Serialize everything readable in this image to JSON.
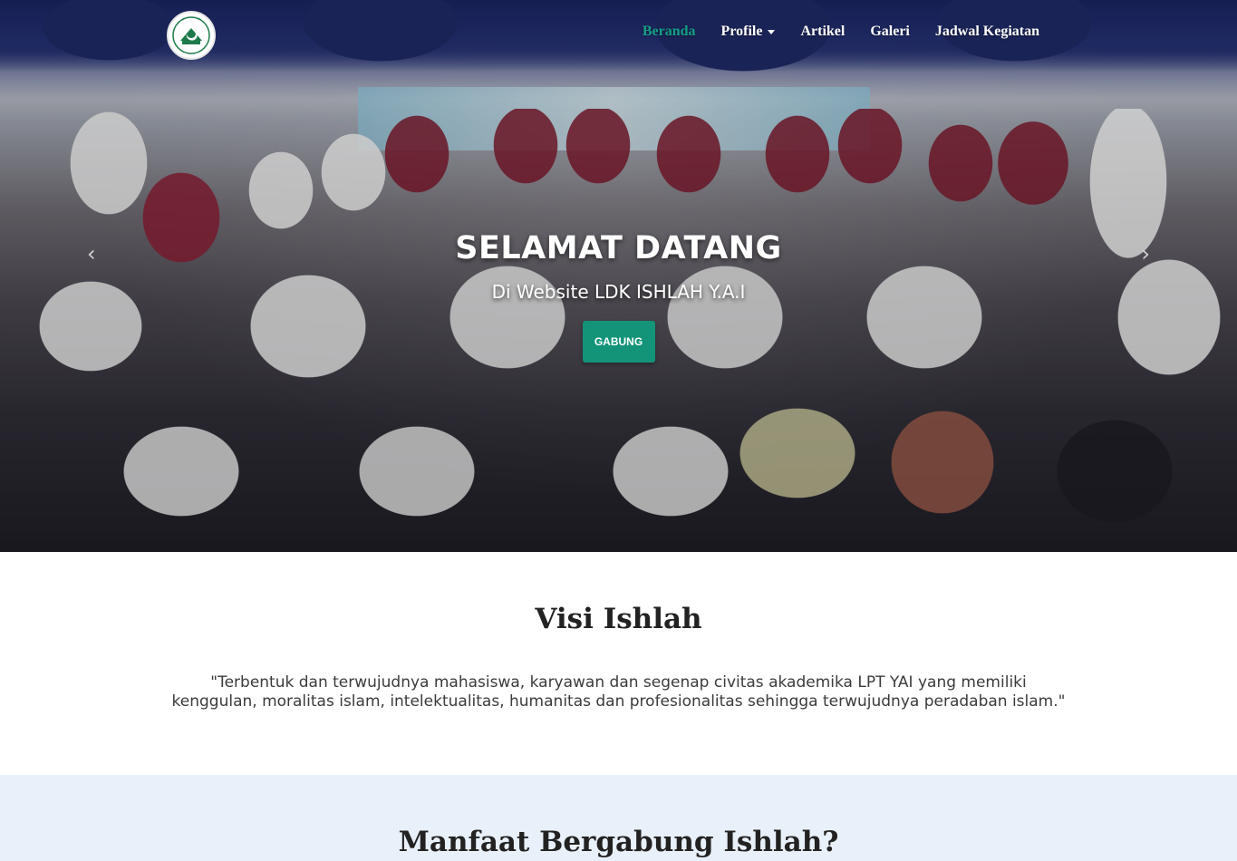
{
  "nav": {
    "logo_alt": "Ishlah",
    "items": [
      {
        "label": "Beranda",
        "active": true
      },
      {
        "label": "Profile",
        "dropdown": true
      },
      {
        "label": "Artikel"
      },
      {
        "label": "Galeri"
      },
      {
        "label": "Jadwal Kegiatan"
      }
    ],
    "active_color": "#14a085"
  },
  "hero": {
    "title": "SELAMAT DATANG",
    "subtitle": "Di Website LDK ISHLAH Y.A.I",
    "button_label": "GABUNG",
    "button_color": "#139479",
    "prev_icon": "chevron-left-icon",
    "next_icon": "chevron-right-icon"
  },
  "visi": {
    "title": "Visi Ishlah",
    "text": "\"Terbentuk dan terwujudnya mahasiswa, karyawan dan segenap civitas akademika LPT YAI yang memiliki kenggulan, moralitas islam, intelektualitas, humanitas dan profesionalitas sehingga terwujudnya peradaban islam.\""
  },
  "manfaat": {
    "title": "Manfaat Bergabung Ishlah?",
    "background": "#e8f0f9"
  }
}
